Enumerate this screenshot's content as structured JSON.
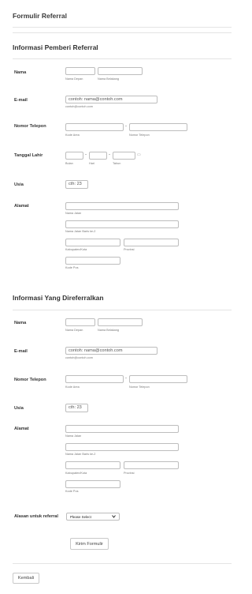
{
  "form_title": "Formulir Referral",
  "sec1": {
    "heading": "Informasi Pemberi Referral",
    "nama": {
      "label": "Nama",
      "sub_first": "Nama Depan",
      "sub_last": "Nama Belakang"
    },
    "email": {
      "label": "E-mail",
      "value": "contoh: nama@contoh.com",
      "sub": "contoh@contoh.com"
    },
    "phone": {
      "label": "Nomor Telepon",
      "sub_area": "Kode Area",
      "sub_num": "Nomor Telepon"
    },
    "dob": {
      "label": "Tanggal Lahir",
      "sub_month": "Bulan",
      "sub_day": "Hari",
      "sub_year": "Tahun"
    },
    "usia": {
      "label": "Usia",
      "value": "cth: 23"
    },
    "alamat": {
      "label": "Alamat",
      "sub_street": "Nama Jalan",
      "sub_street2": "Nama Jalan Baris ke-2",
      "sub_city": "Kabupaten/Kota",
      "sub_province": "Provinsi",
      "sub_postal": "Kode Pos"
    }
  },
  "sec2": {
    "heading": "Informasi Yang Direferralkan",
    "nama": {
      "label": "Nama",
      "sub_first": "Nama Depan",
      "sub_last": "Nama Belakang"
    },
    "email": {
      "label": "E-mail",
      "value": "contoh: nama@contoh.com",
      "sub": "contoh@contoh.com"
    },
    "phone": {
      "label": "Nomor Telepon",
      "sub_area": "Kode Area",
      "sub_num": "Nomor Telepon"
    },
    "usia": {
      "label": "Usia",
      "value": "cth: 23"
    },
    "alamat": {
      "label": "Alamat",
      "sub_street": "Nama Jalan",
      "sub_street2": "Nama Jalan Baris ke-2",
      "sub_city": "Kabupaten/Kota",
      "sub_province": "Provinsi",
      "sub_postal": "Kode Pos"
    }
  },
  "reason": {
    "label": "Alasan untuk referral",
    "selected": "Please Select"
  },
  "dash_symbol": "-",
  "calendar_glyph": "▭",
  "submit_label": "Kirim Formulir",
  "back_label": "Kembali"
}
